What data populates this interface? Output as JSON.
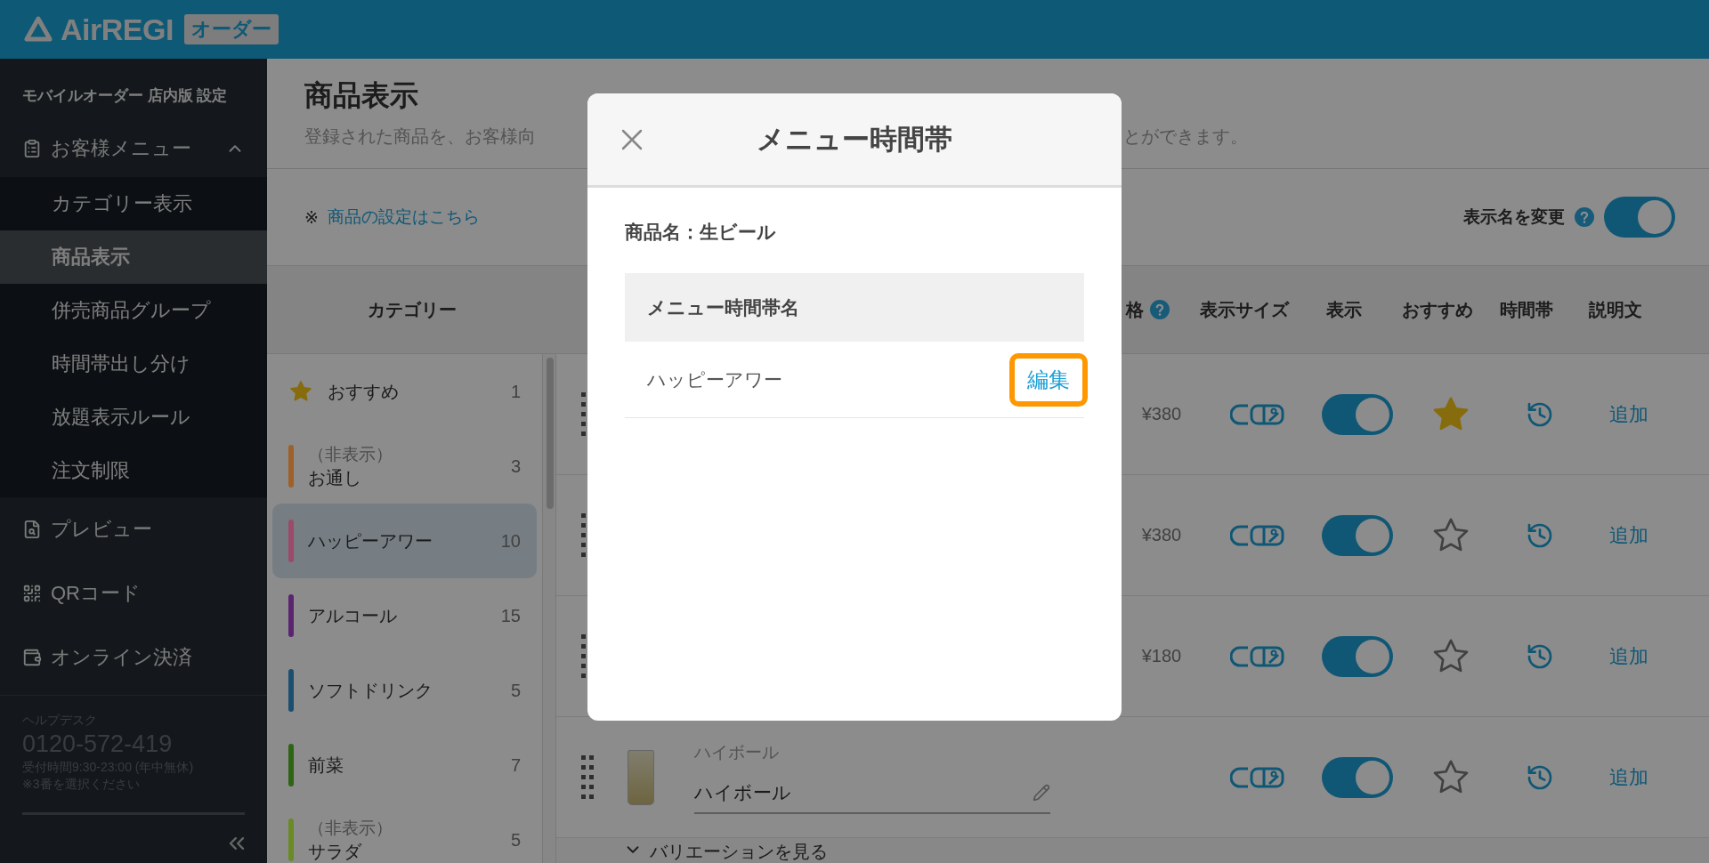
{
  "header": {
    "logo": "AirREGI",
    "badge": "オーダー"
  },
  "sidebar": {
    "title": "モバイルオーダー 店内版 設定",
    "menu": {
      "label": "お客様メニュー",
      "expanded": true,
      "items": [
        {
          "label": "カテゴリー表示",
          "selected": false
        },
        {
          "label": "商品表示",
          "selected": true
        },
        {
          "label": "併売商品グループ",
          "selected": false
        },
        {
          "label": "時間帯出し分け",
          "selected": false
        },
        {
          "label": "放題表示ルール",
          "selected": false
        },
        {
          "label": "注文制限",
          "selected": false
        }
      ]
    },
    "links": [
      {
        "label": "プレビュー",
        "kind": "preview"
      },
      {
        "label": "QRコード",
        "kind": "qr"
      },
      {
        "label": "オンライン決済",
        "kind": "payment"
      }
    ],
    "helpdesk": {
      "label": "ヘルプデスク",
      "phone": "0120-572-419",
      "hours": "受付時間9:30-23:00 (年中無休)",
      "note": "※3番を選択ください"
    }
  },
  "page": {
    "title": "商品表示",
    "description_parts": [
      "登録された商品を、お客様向",
      "とができます。"
    ],
    "settings_link": {
      "prefix": "※",
      "label": "商品の設定はこちら"
    },
    "rename_toggle": {
      "label": "表示名を変更",
      "on": true
    }
  },
  "table": {
    "category_heading": "カテゴリー",
    "columns": [
      {
        "label": "格",
        "help": true
      },
      {
        "label": "表示サイズ",
        "help": false
      },
      {
        "label": "表示",
        "help": false
      },
      {
        "label": "おすすめ",
        "help": false
      },
      {
        "label": "時間帯",
        "help": false
      },
      {
        "label": "説明文",
        "help": false
      }
    ]
  },
  "categories": [
    {
      "label": "おすすめ",
      "count": "1",
      "kind": "starred",
      "selected": false
    },
    {
      "status": "（非表示）",
      "label": "お通し",
      "count": "3",
      "kind": "colored",
      "color": "#a0602a",
      "selected": false
    },
    {
      "label": "ハッピーアワー",
      "count": "10",
      "kind": "colored",
      "color": "#9b4a6a",
      "selected": true
    },
    {
      "label": "アルコール",
      "count": "15",
      "kind": "colored",
      "color": "#5a2470",
      "selected": false
    },
    {
      "label": "ソフトドリンク",
      "count": "5",
      "kind": "colored",
      "color": "#1a4f70",
      "selected": false
    },
    {
      "label": "前菜",
      "count": "7",
      "kind": "colored",
      "color": "#2f6414",
      "selected": false
    },
    {
      "status": "（非表示）",
      "label": "サラダ",
      "count": "5",
      "kind": "colored",
      "color": "#6a8a26",
      "selected": false
    }
  ],
  "products": [
    {
      "price": "¥380",
      "visible": true,
      "recommended": true,
      "add_label": "追加"
    },
    {
      "price": "¥380",
      "visible": true,
      "recommended": false,
      "add_label": "追加"
    },
    {
      "price": "¥180",
      "visible": true,
      "recommended": false,
      "add_label": "追加"
    },
    {
      "photo": true,
      "display_label": "ハイボール",
      "name": "ハイボール",
      "visible": true,
      "recommended": false,
      "add_label": "追加"
    }
  ],
  "variation_label": "バリエーションを見る",
  "modal": {
    "title": "メニュー時間帯",
    "product_label": "商品名：生ビール",
    "column": "メニュー時間帯名",
    "rows": [
      {
        "name": "ハッピーアワー",
        "action": "編集"
      }
    ]
  }
}
